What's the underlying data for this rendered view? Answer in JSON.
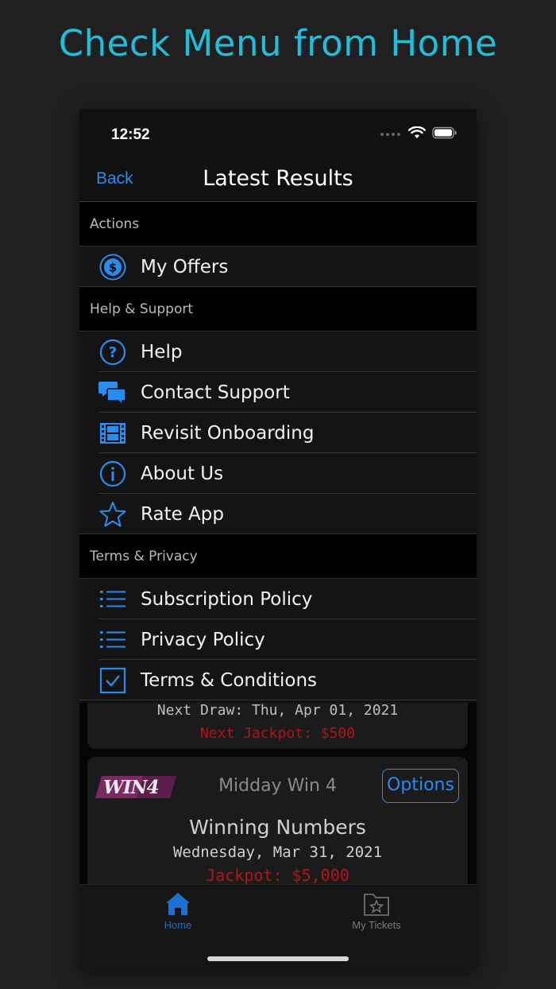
{
  "headline": "Check Menu from Home",
  "status": {
    "time": "12:52"
  },
  "nav": {
    "back_label": "Back",
    "title": "Latest Results"
  },
  "sections": {
    "actions": {
      "header": "Actions",
      "items": [
        {
          "label": "My Offers",
          "icon": "dollar-circle-icon"
        }
      ]
    },
    "help": {
      "header": "Help & Support",
      "items": [
        {
          "label": "Help",
          "icon": "question-circle-icon"
        },
        {
          "label": "Contact Support",
          "icon": "chat-bubbles-icon"
        },
        {
          "label": "Revisit Onboarding",
          "icon": "film-icon"
        },
        {
          "label": "About Us",
          "icon": "info-circle-icon"
        },
        {
          "label": "Rate App",
          "icon": "star-icon"
        }
      ]
    },
    "terms": {
      "header": "Terms & Privacy",
      "items": [
        {
          "label": "Subscription Policy",
          "icon": "list-icon"
        },
        {
          "label": "Privacy Policy",
          "icon": "list-icon"
        },
        {
          "label": "Terms & Conditions",
          "icon": "checkbox-icon"
        }
      ]
    }
  },
  "card_previous": {
    "next_draw": "Next Draw: Thu, Apr 01, 2021",
    "next_jackpot": "Next Jackpot: $500"
  },
  "card_win4": {
    "logo_text": "WIN4",
    "game_name": "Midday Win 4",
    "options_label": "Options",
    "title": "Winning Numbers",
    "date": "Wednesday, Mar 31, 2021",
    "jackpot": "Jackpot: $5,000"
  },
  "tabs": [
    {
      "label": "Home",
      "icon": "home-icon",
      "active": true
    },
    {
      "label": "My Tickets",
      "icon": "ticket-folder-icon",
      "active": false
    }
  ],
  "colors": {
    "accent": "#2b8cf0",
    "headline": "#1fbfdc",
    "jackpot": "#b3141b",
    "win4_logo": "#7a2a63"
  }
}
